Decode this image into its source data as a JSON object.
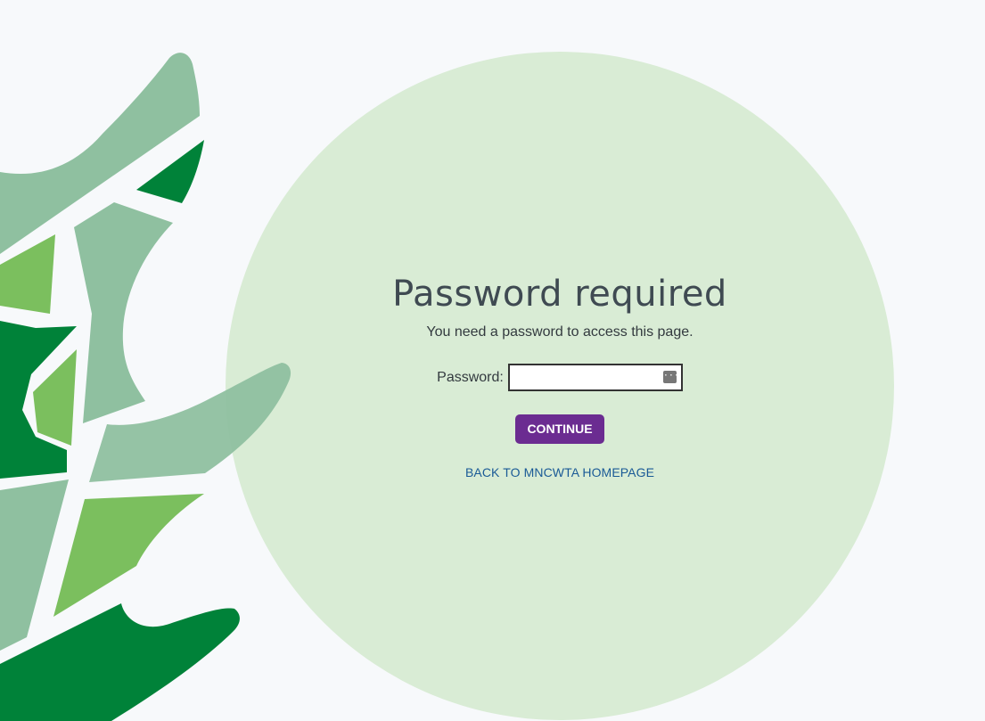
{
  "page": {
    "title": "Password required",
    "subtitle": "You need a password to access this page."
  },
  "form": {
    "password_label": "Password:",
    "password_value": "",
    "password_icon": "password-manager-key-icon",
    "continue_label": "CONTINUE"
  },
  "links": {
    "back_home": "BACK TO MNCWTA HOMEPAGE"
  },
  "colors": {
    "background": "#f7f9fb",
    "circle": "#d9ecd5",
    "button": "#6b2c91",
    "link": "#1a5a96",
    "leaf_dark": "#008239",
    "leaf_light": "#7bbf5e",
    "leaf_sage": "#8fc0a0"
  }
}
